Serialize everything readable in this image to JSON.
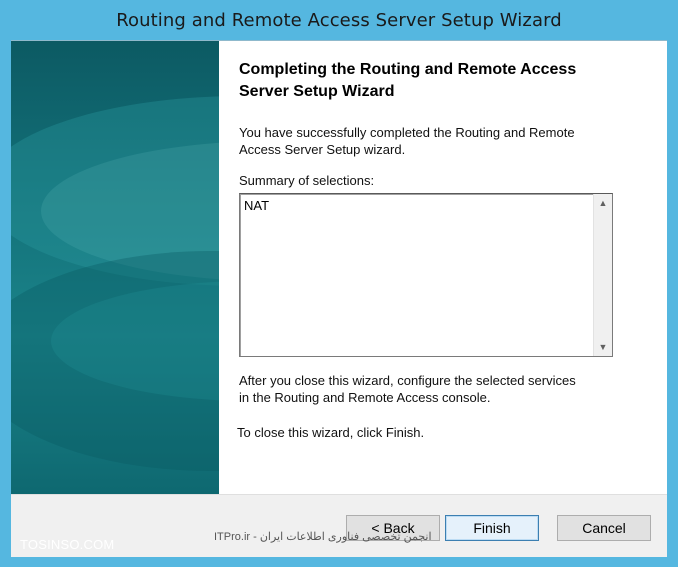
{
  "window": {
    "title": "Routing and Remote Access Server Setup Wizard"
  },
  "content": {
    "heading_line1": "Completing the Routing and Remote Access",
    "heading_line2": "Server Setup Wizard",
    "success_line1": "You have successfully completed the Routing and Remote",
    "success_line2": "Access Server Setup wizard.",
    "summary_label": "Summary of selections:",
    "summary_value": "NAT",
    "after_line1": "After you close this wizard, configure the selected services",
    "after_line2": "in the Routing and  Remote Access console.",
    "close_text": "To close this wizard, click Finish."
  },
  "buttons": {
    "back": "< Back",
    "finish": "Finish",
    "cancel": "Cancel"
  },
  "watermark": {
    "site": "TOSINSO.COM",
    "overlay": "انجمن تخصصی فناوری اطلاعات ایران - ITPro.ir"
  },
  "colors": {
    "chrome": "#55b7e0",
    "banner": "#137179",
    "default_button_border": "#3c7fb1"
  },
  "icons": {
    "scroll_up": "▲",
    "scroll_down": "▼"
  }
}
